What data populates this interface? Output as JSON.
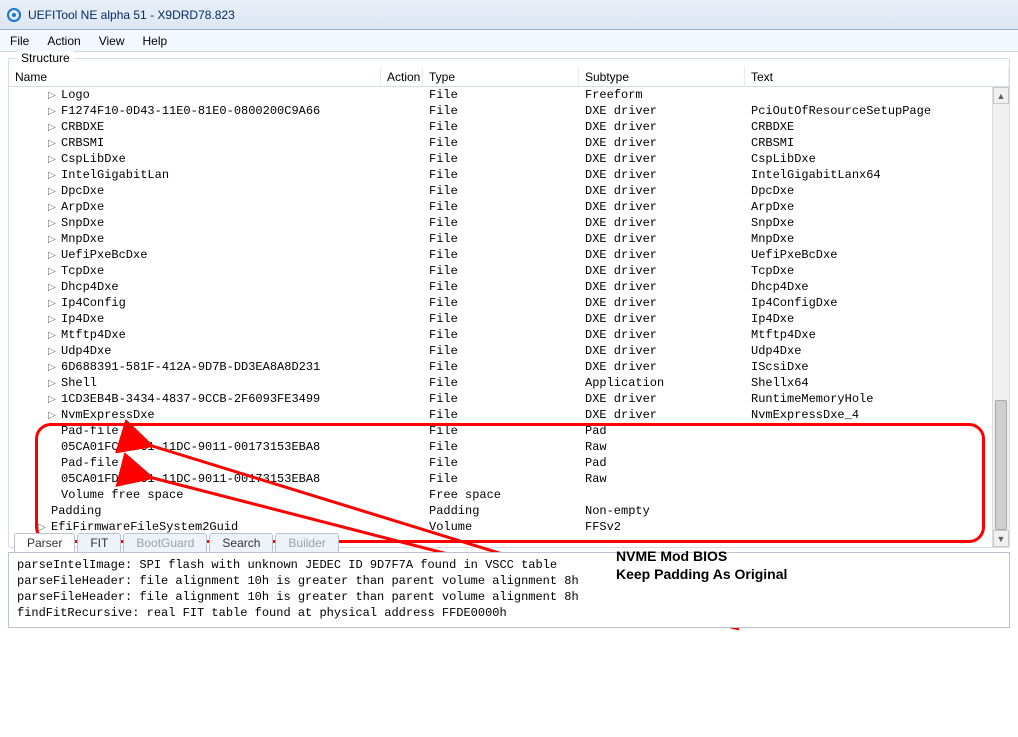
{
  "app": {
    "title": "UEFITool NE alpha 51 - X9DRD78.823"
  },
  "menu": {
    "file": "File",
    "action": "Action",
    "view": "View",
    "help": "Help"
  },
  "structure": {
    "label": "Structure",
    "columns": {
      "name": "Name",
      "action": "Action",
      "type": "Type",
      "subtype": "Subtype",
      "text": "Text"
    },
    "rows": [
      {
        "tw": "▷",
        "name": "Logo",
        "type": "File",
        "subtype": "Freeform",
        "text": ""
      },
      {
        "tw": "▷",
        "name": "F1274F10-0D43-11E0-81E0-0800200C9A66",
        "type": "File",
        "subtype": "DXE driver",
        "text": "PciOutOfResourceSetupPage"
      },
      {
        "tw": "▷",
        "name": "CRBDXE",
        "type": "File",
        "subtype": "DXE driver",
        "text": "CRBDXE"
      },
      {
        "tw": "▷",
        "name": "CRBSMI",
        "type": "File",
        "subtype": "DXE driver",
        "text": "CRBSMI"
      },
      {
        "tw": "▷",
        "name": "CspLibDxe",
        "type": "File",
        "subtype": "DXE driver",
        "text": "CspLibDxe"
      },
      {
        "tw": "▷",
        "name": "IntelGigabitLan",
        "type": "File",
        "subtype": "DXE driver",
        "text": "IntelGigabitLanx64"
      },
      {
        "tw": "▷",
        "name": "DpcDxe",
        "type": "File",
        "subtype": "DXE driver",
        "text": "DpcDxe"
      },
      {
        "tw": "▷",
        "name": "ArpDxe",
        "type": "File",
        "subtype": "DXE driver",
        "text": "ArpDxe"
      },
      {
        "tw": "▷",
        "name": "SnpDxe",
        "type": "File",
        "subtype": "DXE driver",
        "text": "SnpDxe"
      },
      {
        "tw": "▷",
        "name": "MnpDxe",
        "type": "File",
        "subtype": "DXE driver",
        "text": "MnpDxe"
      },
      {
        "tw": "▷",
        "name": "UefiPxeBcDxe",
        "type": "File",
        "subtype": "DXE driver",
        "text": "UefiPxeBcDxe"
      },
      {
        "tw": "▷",
        "name": "TcpDxe",
        "type": "File",
        "subtype": "DXE driver",
        "text": "TcpDxe"
      },
      {
        "tw": "▷",
        "name": "Dhcp4Dxe",
        "type": "File",
        "subtype": "DXE driver",
        "text": "Dhcp4Dxe"
      },
      {
        "tw": "▷",
        "name": "Ip4Config",
        "type": "File",
        "subtype": "DXE driver",
        "text": "Ip4ConfigDxe"
      },
      {
        "tw": "▷",
        "name": "Ip4Dxe",
        "type": "File",
        "subtype": "DXE driver",
        "text": "Ip4Dxe"
      },
      {
        "tw": "▷",
        "name": "Mtftp4Dxe",
        "type": "File",
        "subtype": "DXE driver",
        "text": "Mtftp4Dxe"
      },
      {
        "tw": "▷",
        "name": "Udp4Dxe",
        "type": "File",
        "subtype": "DXE driver",
        "text": "Udp4Dxe"
      },
      {
        "tw": "▷",
        "name": "6D688391-581F-412A-9D7B-DD3EA8A8D231",
        "type": "File",
        "subtype": "DXE driver",
        "text": "IScsiDxe"
      },
      {
        "tw": "▷",
        "name": "Shell",
        "type": "File",
        "subtype": "Application",
        "text": "Shellx64"
      },
      {
        "tw": "▷",
        "name": "1CD3EB4B-3434-4837-9CCB-2F6093FE3499",
        "type": "File",
        "subtype": "DXE driver",
        "text": "RuntimeMemoryHole"
      },
      {
        "tw": "▷",
        "name": "NvmExpressDxe",
        "type": "File",
        "subtype": "DXE driver",
        "text": "NvmExpressDxe_4"
      },
      {
        "tw": "",
        "name": "Pad-file",
        "type": "File",
        "subtype": "Pad",
        "text": ""
      },
      {
        "tw": "",
        "name": "05CA01FC-0FC1-11DC-9011-00173153EBA8",
        "type": "File",
        "subtype": "Raw",
        "text": ""
      },
      {
        "tw": "",
        "name": "Pad-file",
        "type": "File",
        "subtype": "Pad",
        "text": ""
      },
      {
        "tw": "",
        "name": "05CA01FD-0FC1-11DC-9011-00173153EBA8",
        "type": "File",
        "subtype": "Raw",
        "text": ""
      },
      {
        "tw": "",
        "name": "Volume free space",
        "type": "Free space",
        "subtype": "",
        "text": ""
      },
      {
        "tw": "",
        "name": "Padding",
        "type": "Padding",
        "subtype": "Non-empty",
        "text": "",
        "outdent": true
      },
      {
        "tw": "▷",
        "name": "EfiFirmwareFileSystem2Guid",
        "type": "Volume",
        "subtype": "FFSv2",
        "text": "",
        "outdent": true
      }
    ]
  },
  "tabs": {
    "parser": "Parser",
    "fit": "FIT",
    "bootguard": "BootGuard",
    "search": "Search",
    "builder": "Builder"
  },
  "parser": {
    "lines": [
      "parseIntelImage: SPI flash with unknown JEDEC ID 9D7F7A found in VSCC table",
      "parseFileHeader: file alignment 10h is greater than parent volume alignment 8h",
      "parseFileHeader: file alignment 10h is greater than parent volume alignment 8h",
      "findFitRecursive: real FIT table found at physical address FFDE0000h"
    ]
  },
  "annotation": {
    "line1": "NVME Mod BIOS",
    "line2": "Keep Padding As Original"
  }
}
